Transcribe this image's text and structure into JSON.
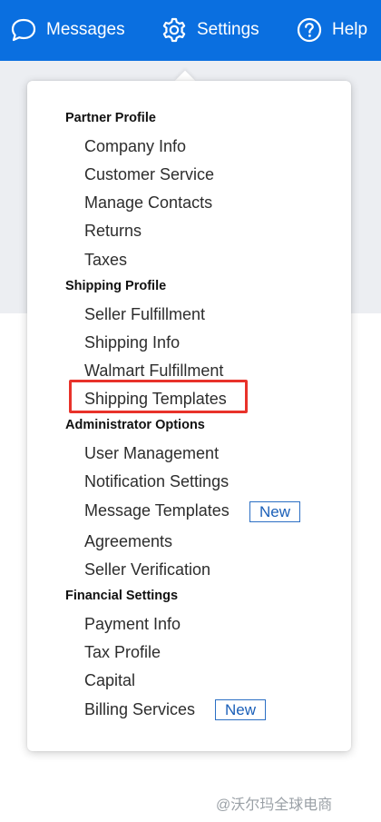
{
  "header": {
    "messages_label": "Messages",
    "settings_label": "Settings",
    "help_label": "Help",
    "background_color": "#0a6fe0"
  },
  "menu": {
    "sections": [
      {
        "title": "Partner Profile",
        "items": [
          "Company Info",
          "Customer Service",
          "Manage Contacts",
          "Returns",
          "Taxes"
        ]
      },
      {
        "title": "Shipping Profile",
        "items": [
          "Seller Fulfillment",
          "Shipping Info",
          "Walmart Fulfillment",
          "Shipping Templates"
        ]
      },
      {
        "title": "Administrator Options",
        "items": [
          "User Management",
          "Notification Settings",
          "Message Templates",
          "Agreements",
          "Seller Verification"
        ]
      },
      {
        "title": "Financial Settings",
        "items": [
          "Payment Info",
          "Tax Profile",
          "Capital",
          "Billing Services"
        ]
      }
    ],
    "badges": {
      "message_templates": "New",
      "billing_services": "New"
    },
    "highlighted_item": "Shipping Templates",
    "highlight_color": "#e8322a"
  },
  "watermark": "@沃尔玛全球电商"
}
